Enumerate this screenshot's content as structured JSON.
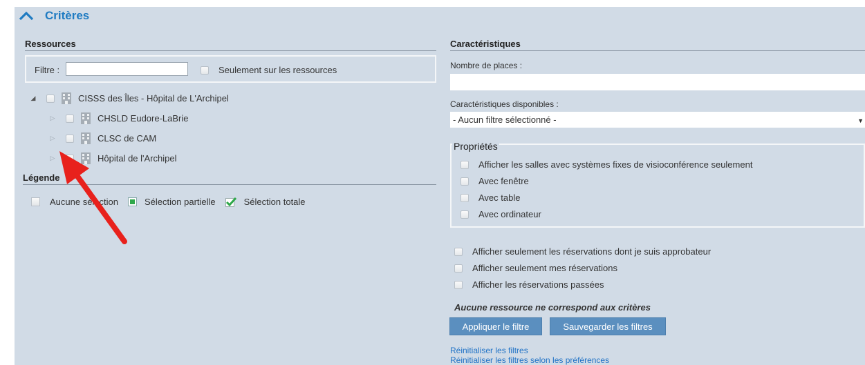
{
  "header": {
    "title": "Critères"
  },
  "resources": {
    "title": "Ressources",
    "filter_label": "Filtre :",
    "filter_value": "",
    "only_resources_label": "Seulement sur les ressources",
    "tree": [
      {
        "label": "CISSS des Îles - Hôpital de L'Archipel",
        "expanded": true
      },
      {
        "label": "CHSLD Eudore-LaBrie"
      },
      {
        "label": "CLSC de CAM"
      },
      {
        "label": "Hôpital de l'Archipel"
      }
    ]
  },
  "legend": {
    "title": "Légende",
    "none": "Aucune sélection",
    "partial": "Sélection partielle",
    "total": "Sélection totale"
  },
  "characteristics": {
    "title": "Caractéristiques",
    "places_label": "Nombre de places :",
    "places_value": "",
    "available_label": "Caractéristiques disponibles :",
    "available_selected": "- Aucun filtre sélectionné -"
  },
  "properties": {
    "title": "Propriétés",
    "items": [
      "Afficher les salles avec systèmes fixes de visioconférence seulement",
      "Avec fenêtre",
      "Avec table",
      "Avec ordinateur"
    ]
  },
  "options": [
    "Afficher seulement les réservations dont je suis approbateur",
    "Afficher seulement mes réservations",
    "Afficher les réservations passées"
  ],
  "notice": "Aucune ressource ne correspond aux critères",
  "buttons": {
    "apply": "Appliquer le filtre",
    "save": "Sauvegarder les filtres"
  },
  "links": {
    "reset": "Réinitialiser les filtres",
    "reset_prefs": "Réinitialiser les filtres selon les préférences"
  },
  "colors": {
    "panel": "#d1dbe6",
    "accent": "#1f7bc2",
    "button": "#5b8fbf",
    "arrow": "#e8211c"
  }
}
